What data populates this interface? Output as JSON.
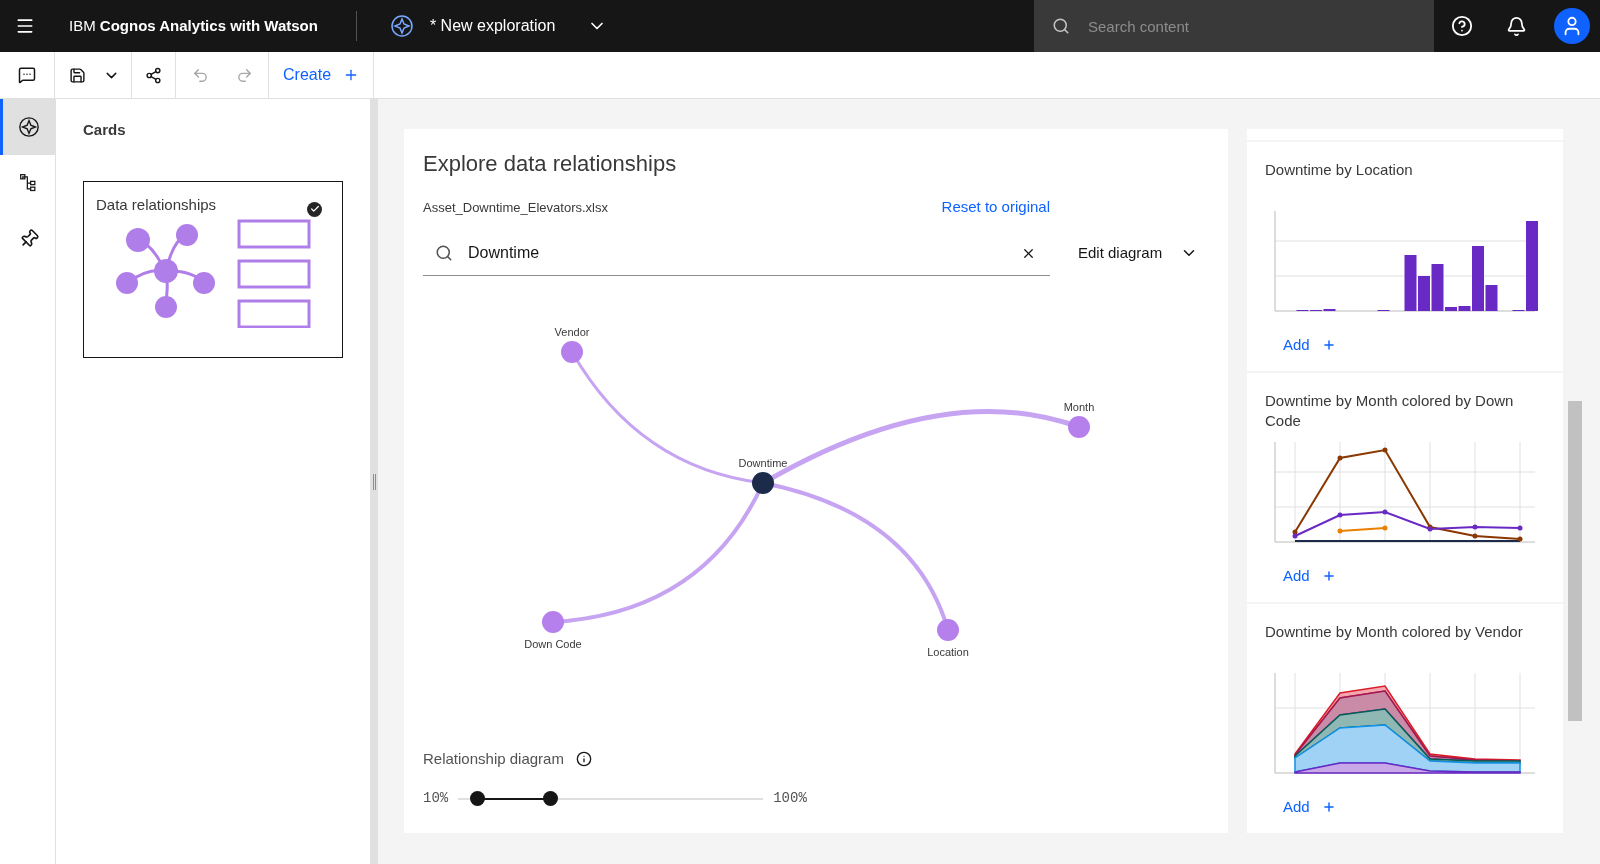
{
  "header": {
    "brand_prefix": "IBM",
    "brand_name": "Cognos Analytics with Watson",
    "exploration_title": "* New exploration",
    "search": {
      "placeholder": "Search content"
    }
  },
  "toolbar": {
    "create": "Create"
  },
  "rail": [
    {
      "kind": "explore",
      "selected": true
    },
    {
      "kind": "tree",
      "selected": false
    },
    {
      "kind": "pin",
      "selected": false
    }
  ],
  "panel": {
    "title": "Cards",
    "cards": [
      {
        "title": "Data relationships",
        "selected": true
      }
    ]
  },
  "explore": {
    "title": "Explore data relationships",
    "file": "Asset_Downtime_Elevators.xlsx",
    "reset": "Reset to original",
    "search": {
      "value": "Downtime"
    },
    "edit": "Edit diagram",
    "nodes": [
      {
        "label": "Vendor",
        "selected": false
      },
      {
        "label": "Month",
        "selected": false
      },
      {
        "label": "Downtime",
        "selected": true
      },
      {
        "label": "Down Code",
        "selected": false
      },
      {
        "label": "Location",
        "selected": false
      }
    ],
    "slider": {
      "label": "Relationship diagram",
      "min_label": "10%",
      "max_label": "100%",
      "thumbs": [
        {
          "level": 0.06
        },
        {
          "level": 0.3
        }
      ]
    }
  },
  "suggestions": [
    {
      "title": "Downtime by Location",
      "kind": "bar",
      "action": "Add"
    },
    {
      "title": "Downtime by Month colored by Down Code",
      "kind": "line",
      "action": "Add"
    },
    {
      "title": "Downtime by Month colored by Vendor",
      "kind": "area",
      "action": "Add"
    }
  ]
}
